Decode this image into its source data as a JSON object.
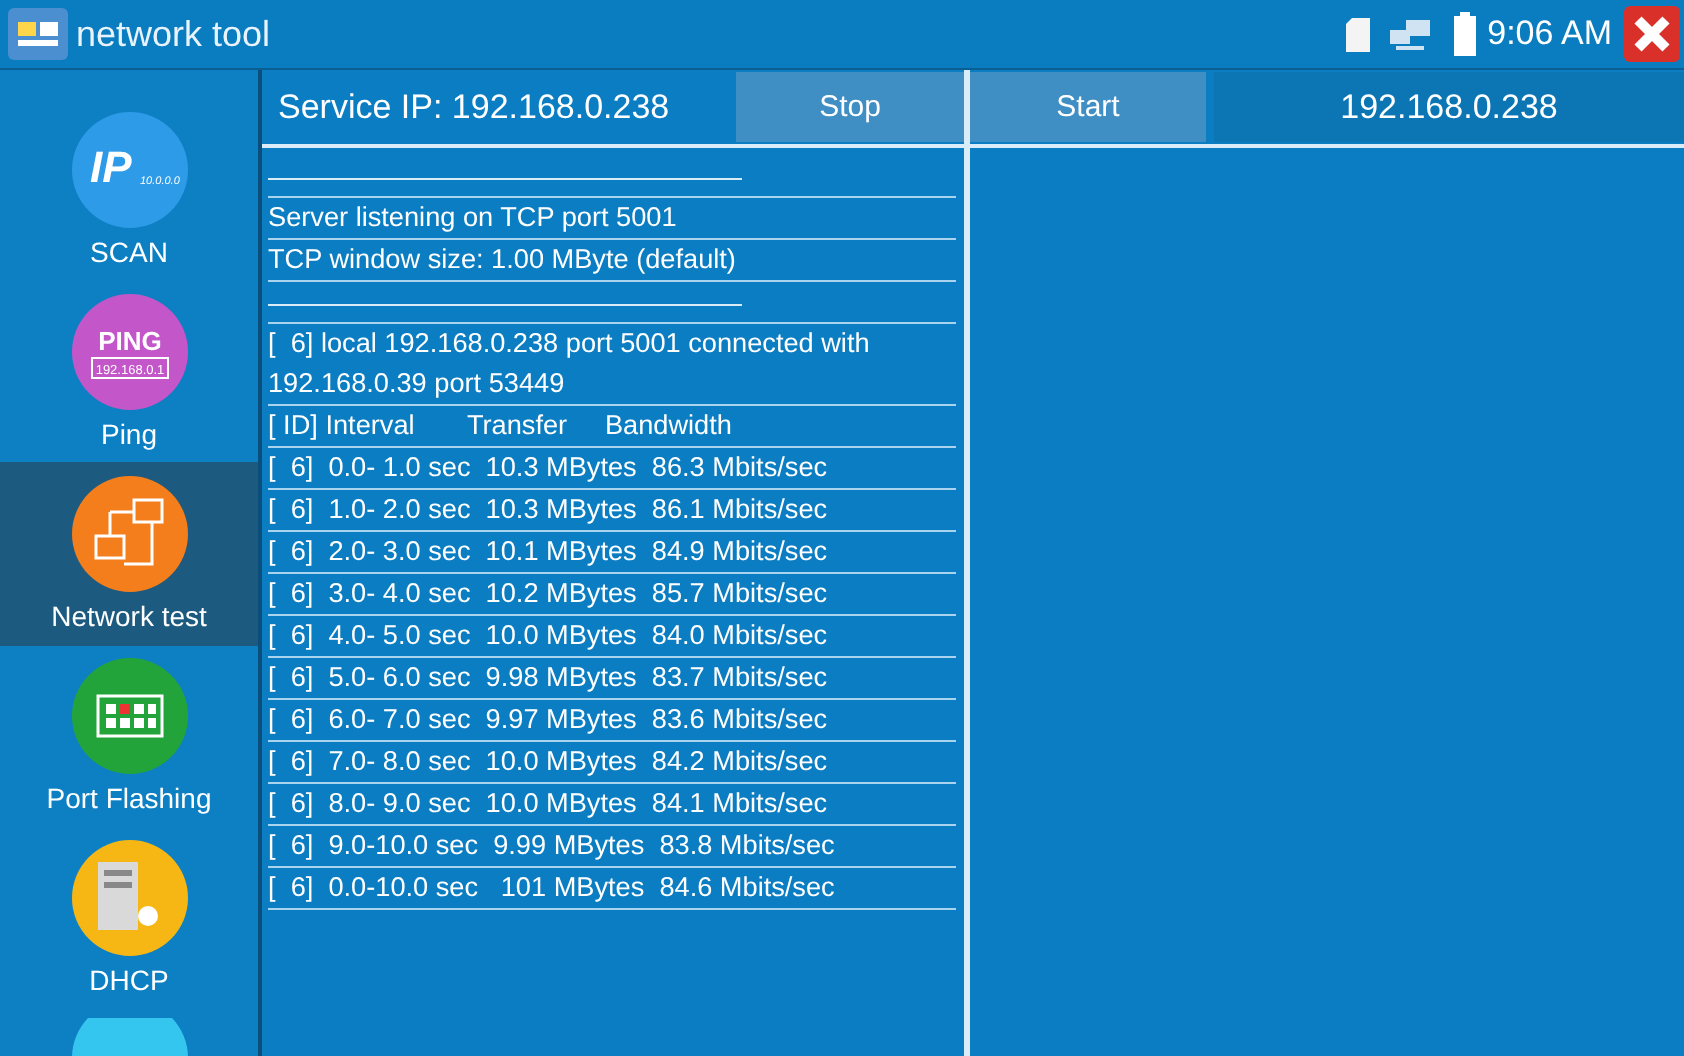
{
  "window": {
    "title": "network tool",
    "time": "9:06 AM"
  },
  "sidebar": {
    "items": [
      {
        "label": "SCAN",
        "badge": "IP",
        "caption": "10.0.0.0",
        "selected": false
      },
      {
        "label": "Ping",
        "badge": "PING",
        "caption": "192.168.0.1",
        "selected": false
      },
      {
        "label": "Network test",
        "selected": true
      },
      {
        "label": "Port Flashing",
        "selected": false
      },
      {
        "label": "DHCP",
        "selected": false
      },
      {
        "selected": false
      }
    ]
  },
  "server": {
    "label": "Service IP: 192.168.0.238",
    "button": "Stop",
    "log": [
      {
        "kind": "rule"
      },
      {
        "kind": "text",
        "text": "Server listening on TCP port 5001"
      },
      {
        "kind": "text",
        "text": "TCP window size: 1.00 MByte (default)"
      },
      {
        "kind": "rule"
      },
      {
        "kind": "text",
        "text": "[  6] local 192.168.0.238 port 5001 connected with 192.168.0.39 port 53449"
      },
      {
        "kind": "text",
        "text": "[ ID] Interval       Transfer     Bandwidth"
      },
      {
        "kind": "text",
        "text": "[  6]  0.0- 1.0 sec  10.3 MBytes  86.3 Mbits/sec"
      },
      {
        "kind": "text",
        "text": "[  6]  1.0- 2.0 sec  10.3 MBytes  86.1 Mbits/sec"
      },
      {
        "kind": "text",
        "text": "[  6]  2.0- 3.0 sec  10.1 MBytes  84.9 Mbits/sec"
      },
      {
        "kind": "text",
        "text": "[  6]  3.0- 4.0 sec  10.2 MBytes  85.7 Mbits/sec"
      },
      {
        "kind": "text",
        "text": "[  6]  4.0- 5.0 sec  10.0 MBytes  84.0 Mbits/sec"
      },
      {
        "kind": "text",
        "text": "[  6]  5.0- 6.0 sec  9.98 MBytes  83.7 Mbits/sec"
      },
      {
        "kind": "text",
        "text": "[  6]  6.0- 7.0 sec  9.97 MBytes  83.6 Mbits/sec"
      },
      {
        "kind": "text",
        "text": "[  6]  7.0- 8.0 sec  10.0 MBytes  84.2 Mbits/sec"
      },
      {
        "kind": "text",
        "text": "[  6]  8.0- 9.0 sec  10.0 MBytes  84.1 Mbits/sec"
      },
      {
        "kind": "text",
        "text": "[  6]  9.0-10.0 sec  9.99 MBytes  83.8 Mbits/sec"
      },
      {
        "kind": "text",
        "text": "[  6]  0.0-10.0 sec   101 MBytes  84.6 Mbits/sec"
      }
    ]
  },
  "client": {
    "button": "Start",
    "ip": "192.168.0.238"
  }
}
